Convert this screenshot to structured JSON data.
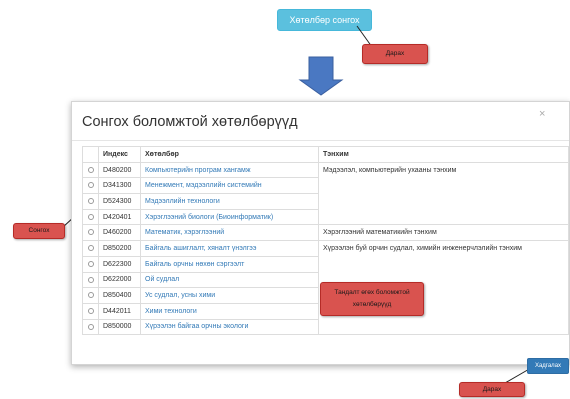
{
  "top_button": {
    "label": "Хөтөлбөр сонгох"
  },
  "callouts": {
    "top": "Дарах",
    "select": "Сонгох",
    "table_note_line1": "Тандалт өгөх боломжтой",
    "table_note_line2": "хөтөлбөрүүд",
    "bottom": "Дарах"
  },
  "modal": {
    "title": "Сонгох боломжтой хөтөлбөрүүд",
    "close": "×",
    "columns": {
      "code": "Индекс",
      "program": "Хөтөлбөр",
      "department": "Тэнхим"
    },
    "rows": [
      {
        "code": "D480200",
        "program": "Компьютерийн програм хангамж"
      },
      {
        "code": "D341300",
        "program": "Менежмент, мэдээллийн системийн"
      },
      {
        "code": "D524300",
        "program": "Мэдээллийн технологи"
      },
      {
        "code": "D420401",
        "program": "Хэрэглээний биологи (Биоинформатик)"
      },
      {
        "code": "D460200",
        "program": "Математик, хэрэглээний"
      },
      {
        "code": "D850200",
        "program": "Байгаль ашиглалт, хяналт үнэлгээ"
      },
      {
        "code": "D622300",
        "program": "Байгаль орчны нөхөн сэргээлт"
      },
      {
        "code": "D622000",
        "program": "Ой судлал"
      },
      {
        "code": "D850400",
        "program": "Ус судлал, усны хими"
      },
      {
        "code": "D442011",
        "program": "Хими технологи"
      },
      {
        "code": "D850000",
        "program": "Хүрээлэн байгаа орчны экологи"
      }
    ],
    "departments": [
      "Мэдээлэл, компьютерийн ухааны тэнхим",
      "Хэрэглээний математикийн тэнхим",
      "Хүрээлэн буй орчин судлал, химийн инженерчлэлийн тэнхим"
    ]
  },
  "save_button": {
    "label": "Хадгалах"
  },
  "colors": {
    "info_button": "#5bc0de",
    "primary_button": "#337ab7",
    "callout": "#d9534f",
    "down_arrow": "#4a78c2",
    "link": "#337ab7"
  }
}
